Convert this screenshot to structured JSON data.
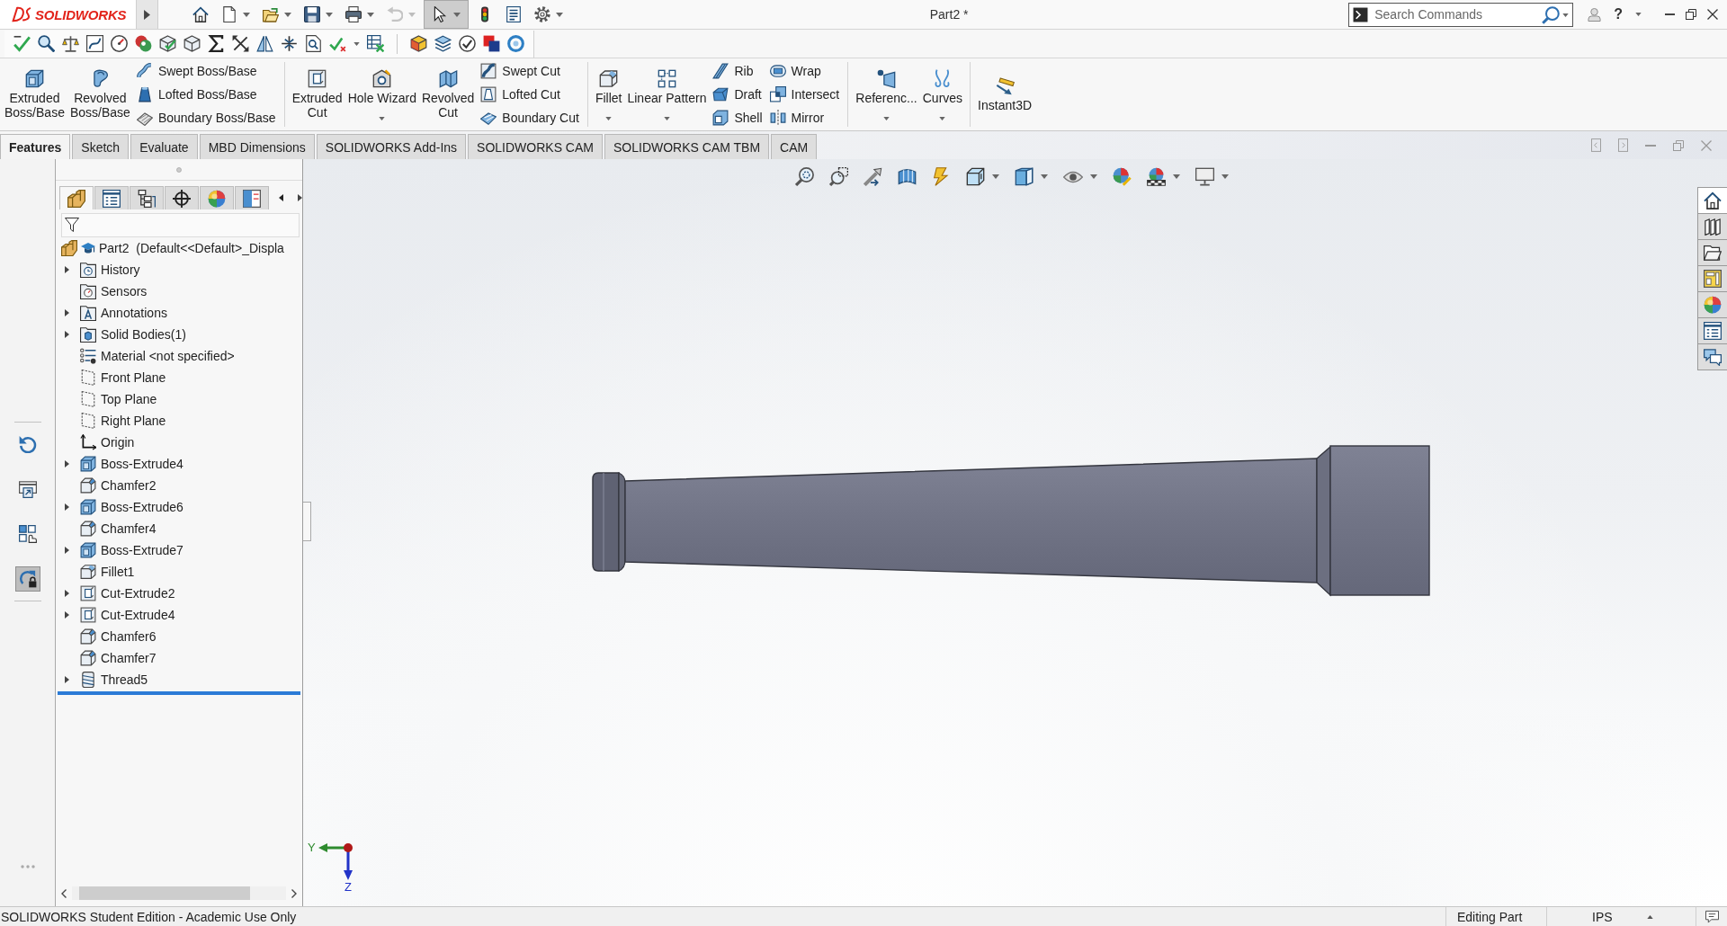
{
  "title_bar": {
    "app_name": "SOLIDWORKS",
    "quick_access": [
      {
        "dropdown": false,
        "disabled": false,
        "pressed": false
      },
      {
        "dropdown": true,
        "disabled": false,
        "pressed": false
      },
      {
        "dropdown": true,
        "disabled": false,
        "pressed": false
      },
      {
        "dropdown": true,
        "disabled": false,
        "pressed": false
      },
      {
        "dropdown": true,
        "disabled": false,
        "pressed": false
      },
      {
        "dropdown": true,
        "disabled": true,
        "pressed": false
      },
      {
        "dropdown": true,
        "disabled": false,
        "pressed": true
      },
      {
        "dropdown": false,
        "disabled": false,
        "pressed": false
      },
      {
        "dropdown": false,
        "disabled": false,
        "pressed": false
      },
      {
        "dropdown": true,
        "disabled": false,
        "pressed": false
      }
    ],
    "document_title": "Part2 *",
    "search": {
      "placeholder": "Search Commands"
    },
    "help_label": "?"
  },
  "ribbon": {
    "groups": [
      {
        "columns": [
          {
            "kind": "large",
            "label": "Extruded\nBoss/Base",
            "dropdown": false
          },
          {
            "kind": "large",
            "label": "Revolved\nBoss/Base",
            "dropdown": false
          },
          {
            "kind": "stack",
            "items": [
              "Swept Boss/Base",
              "Lofted Boss/Base",
              "Boundary Boss/Base"
            ]
          }
        ]
      },
      {
        "columns": [
          {
            "kind": "large",
            "label": "Extruded\nCut",
            "dropdown": false
          },
          {
            "kind": "large",
            "label": "Hole Wizard",
            "dropdown": true
          },
          {
            "kind": "large",
            "label": "Revolved\nCut",
            "dropdown": false
          },
          {
            "kind": "stack",
            "items": [
              "Swept Cut",
              "Lofted Cut",
              "Boundary Cut"
            ]
          }
        ]
      },
      {
        "columns": [
          {
            "kind": "large",
            "label": "Fillet",
            "dropdown": true
          },
          {
            "kind": "large",
            "label": "Linear Pattern",
            "dropdown": true
          },
          {
            "kind": "stack",
            "items": [
              "Rib",
              "Draft",
              "Shell"
            ]
          },
          {
            "kind": "stack",
            "items": [
              "Wrap",
              "Intersect",
              "Mirror"
            ]
          }
        ]
      },
      {
        "columns": [
          {
            "kind": "large",
            "label": "Referenc...",
            "dropdown": true
          },
          {
            "kind": "large",
            "label": "Curves",
            "dropdown": true
          }
        ]
      },
      {
        "columns": [
          {
            "kind": "large",
            "label": "Instant3D",
            "dropdown": false
          }
        ]
      }
    ]
  },
  "command_tabs": [
    {
      "label": "Features",
      "selected": true
    },
    {
      "label": "Sketch",
      "selected": false
    },
    {
      "label": "Evaluate",
      "selected": false
    },
    {
      "label": "MBD Dimensions",
      "selected": false
    },
    {
      "label": "SOLIDWORKS Add-Ins",
      "selected": false
    },
    {
      "label": "SOLIDWORKS CAM",
      "selected": false
    },
    {
      "label": "SOLIDWORKS CAM TBM",
      "selected": false
    },
    {
      "label": "CAM",
      "selected": false
    }
  ],
  "left_toolbar": [
    {
      "pressed": false
    },
    {
      "pressed": false
    },
    {
      "pressed": false
    },
    {
      "pressed": true
    }
  ],
  "feature_manager": {
    "tabs": [
      {
        "selected": true
      },
      {
        "selected": false
      },
      {
        "selected": false
      },
      {
        "selected": false
      },
      {
        "selected": false
      },
      {
        "selected": false
      }
    ],
    "root": {
      "label": "Part2  (Default<<Default>_Displa"
    },
    "items": [
      {
        "kind": "history",
        "label": "History",
        "expandable": true
      },
      {
        "kind": "sensors",
        "label": "Sensors",
        "expandable": false
      },
      {
        "kind": "annotations",
        "label": "Annotations",
        "expandable": true
      },
      {
        "kind": "bodies",
        "label": "Solid Bodies(1)",
        "expandable": true
      },
      {
        "kind": "material",
        "label": "Material <not specified>",
        "expandable": false
      },
      {
        "kind": "plane",
        "label": "Front Plane",
        "expandable": false
      },
      {
        "kind": "plane",
        "label": "Top Plane",
        "expandable": false
      },
      {
        "kind": "plane",
        "label": "Right Plane",
        "expandable": false
      },
      {
        "kind": "origin",
        "label": "Origin",
        "expandable": false
      },
      {
        "kind": "extrude",
        "label": "Boss-Extrude4",
        "expandable": true
      },
      {
        "kind": "chamfer",
        "label": "Chamfer2",
        "expandable": false
      },
      {
        "kind": "extrude",
        "label": "Boss-Extrude6",
        "expandable": true
      },
      {
        "kind": "chamfer",
        "label": "Chamfer4",
        "expandable": false
      },
      {
        "kind": "extrude",
        "label": "Boss-Extrude7",
        "expandable": true
      },
      {
        "kind": "fillet",
        "label": "Fillet1",
        "expandable": false
      },
      {
        "kind": "cut",
        "label": "Cut-Extrude2",
        "expandable": true
      },
      {
        "kind": "cut",
        "label": "Cut-Extrude4",
        "expandable": true
      },
      {
        "kind": "chamfer",
        "label": "Chamfer6",
        "expandable": false
      },
      {
        "kind": "chamfer",
        "label": "Chamfer7",
        "expandable": false
      },
      {
        "kind": "thread",
        "label": "Thread5",
        "expandable": true
      }
    ]
  },
  "graphics_area": {
    "heads_up_toolbar": [
      {
        "dropdown": false
      },
      {
        "dropdown": false
      },
      {
        "dropdown": false
      },
      {
        "dropdown": false
      },
      {
        "dropdown": false
      },
      {
        "dropdown": true
      },
      {
        "dropdown": true
      },
      {
        "dropdown": true
      },
      {
        "dropdown": false
      },
      {
        "dropdown": true
      },
      {
        "dropdown": true
      }
    ],
    "triad": {
      "y_label": "Y",
      "z_label": "Z"
    },
    "task_pane_tabs": [
      {
        "selected": true
      },
      {
        "selected": false
      },
      {
        "selected": false
      },
      {
        "selected": false
      },
      {
        "selected": false
      },
      {
        "selected": false
      },
      {
        "selected": false
      }
    ]
  },
  "status_bar": {
    "message": "SOLIDWORKS Student Edition - Academic Use Only",
    "mode": "Editing Part",
    "units": "IPS"
  }
}
